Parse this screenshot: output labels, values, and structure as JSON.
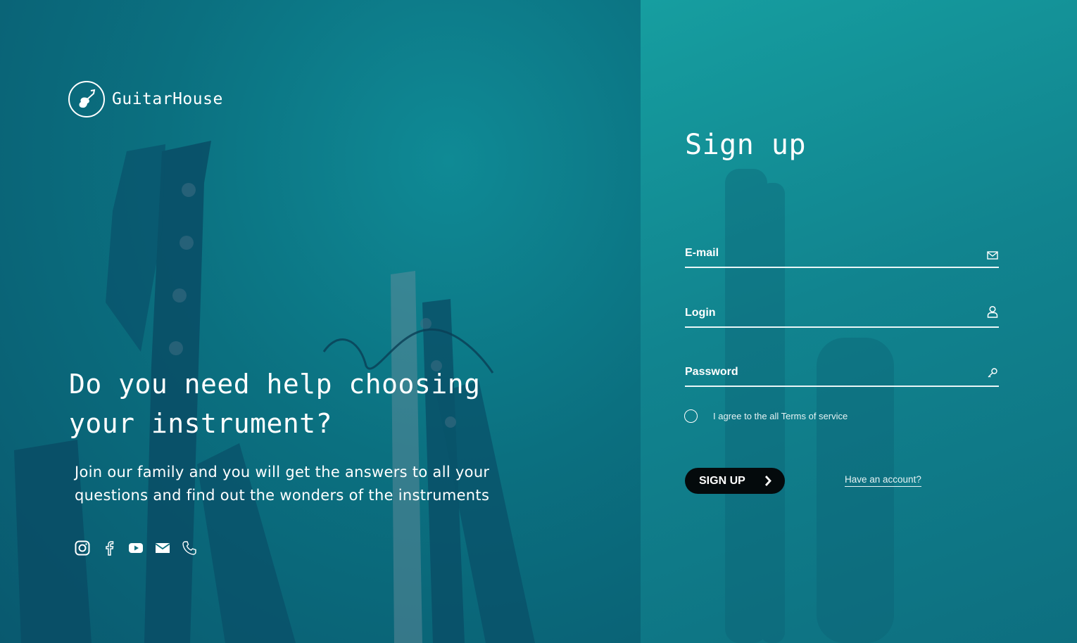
{
  "brand": {
    "name": "GuitarHouse",
    "logo_icon": "guitar-icon"
  },
  "hero": {
    "headline": "Do you need help choosing your instrument?",
    "subtext": "Join our  family and you will get the answers to all your questions and  find out the wonders of the instruments"
  },
  "socials": [
    {
      "name": "instagram-icon"
    },
    {
      "name": "facebook-icon"
    },
    {
      "name": "youtube-icon"
    },
    {
      "name": "mail-icon"
    },
    {
      "name": "phone-icon"
    }
  ],
  "form": {
    "title": "Sign up",
    "email": {
      "placeholder": "E-mail",
      "value": "",
      "icon": "envelope-icon"
    },
    "login": {
      "placeholder": "Login",
      "value": "",
      "icon": "user-icon"
    },
    "password": {
      "placeholder": "Password",
      "value": "",
      "icon": "key-icon"
    },
    "agree_label": "I agree to the all Terms of service",
    "submit_label": "SIGN UP",
    "have_account": "Have an account?"
  },
  "colors": {
    "left_bg": "#0b7080",
    "right_bg": "#139aa0",
    "button": "#040a0c",
    "text": "#ffffff"
  }
}
